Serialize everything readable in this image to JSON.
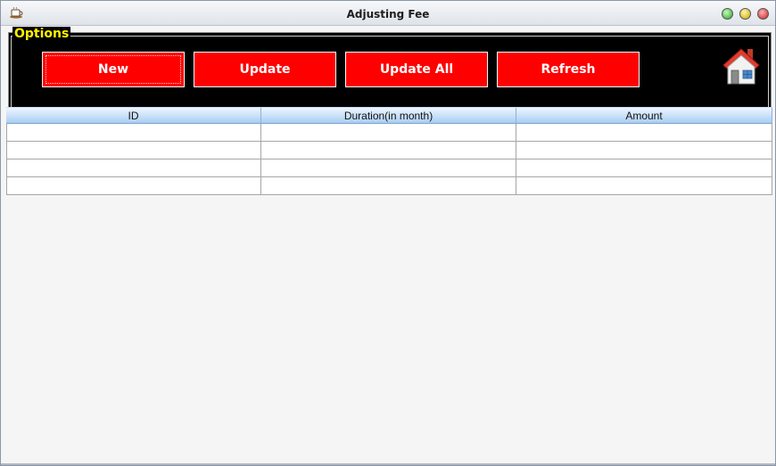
{
  "window": {
    "title": "Adjusting Fee"
  },
  "options": {
    "legend": "Options",
    "buttons": {
      "new": "New",
      "update": "Update",
      "update_all": "Update All",
      "refresh": "Refresh"
    },
    "home_icon": "home-icon"
  },
  "table": {
    "columns": [
      "ID",
      "Duration(in month)",
      "Amount"
    ],
    "rows": [
      [
        "",
        "",
        ""
      ],
      [
        "",
        "",
        ""
      ],
      [
        "",
        "",
        ""
      ],
      [
        "",
        "",
        ""
      ]
    ]
  },
  "colors": {
    "button_bg": "#ff0000",
    "legend": "#ffee00",
    "panel_bg": "#000000",
    "header_grad_bottom": "#a9cdf2"
  }
}
